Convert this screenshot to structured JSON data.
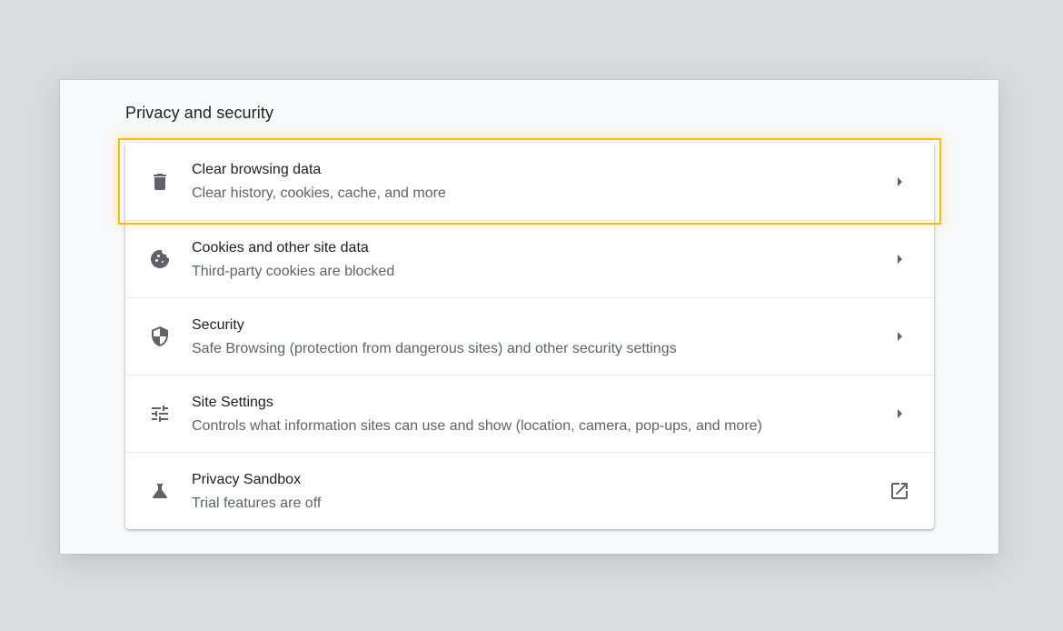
{
  "section": {
    "title": "Privacy and security"
  },
  "colors": {
    "highlight": "#fbbc04",
    "icon": "#5f6368",
    "text_primary": "#202124",
    "text_secondary": "#5f6368"
  },
  "items": [
    {
      "title": "Clear browsing data",
      "subtitle": "Clear history, cookies, cache, and more",
      "icon": "trash-icon",
      "action_icon": "arrow-right-icon",
      "highlighted": true
    },
    {
      "title": "Cookies and other site data",
      "subtitle": "Third-party cookies are blocked",
      "icon": "cookie-icon",
      "action_icon": "arrow-right-icon",
      "highlighted": false
    },
    {
      "title": "Security",
      "subtitle": "Safe Browsing (protection from dangerous sites) and other security settings",
      "icon": "shield-icon",
      "action_icon": "arrow-right-icon",
      "highlighted": false
    },
    {
      "title": "Site Settings",
      "subtitle": "Controls what information sites can use and show (location, camera, pop-ups, and more)",
      "icon": "tune-icon",
      "action_icon": "arrow-right-icon",
      "highlighted": false
    },
    {
      "title": "Privacy Sandbox",
      "subtitle": "Trial features are off",
      "icon": "flask-icon",
      "action_icon": "open-in-new-icon",
      "highlighted": false
    }
  ]
}
